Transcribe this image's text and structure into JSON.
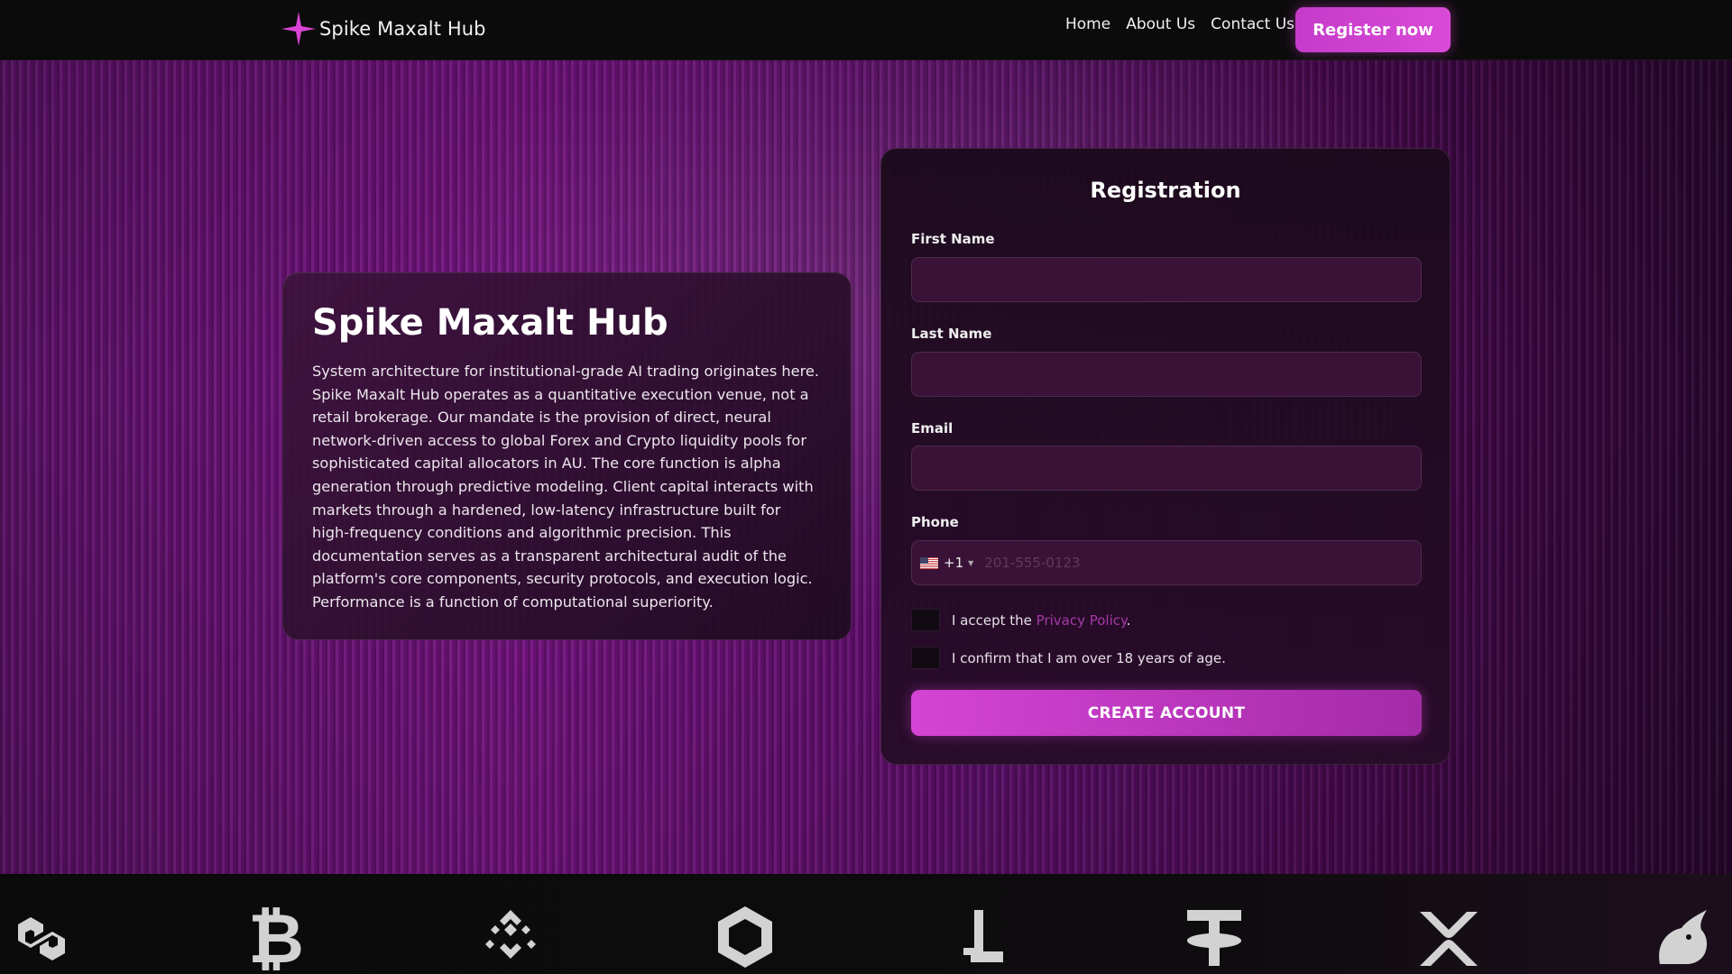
{
  "header": {
    "brand_name": "Spike Maxalt Hub",
    "nav": [
      "Home",
      "About Us",
      "Contact Us"
    ],
    "register_label": "Register now"
  },
  "info": {
    "title": "Spike Maxalt Hub",
    "text": "System architecture for institutional-grade AI trading originates here. Spike Maxalt Hub operates as a quantitative execution venue, not a retail brokerage. Our mandate is the provision of direct, neural network-driven access to global Forex and Crypto liquidity pools for sophisticated capital allocators in AU. The core function is alpha generation through predictive modeling. Client capital interacts with markets through a hardened, low-latency infrastructure built for high-frequency conditions and algorithmic precision. This documentation serves as a transparent architectural audit of the platform's core components, security protocols, and execution logic. Performance is a function of computational superiority."
  },
  "registration": {
    "title": "Registration",
    "first_name_label": "First Name",
    "last_name_label": "Last Name",
    "email_label": "Email",
    "phone_label": "Phone",
    "phone_dial_code": "+1",
    "phone_placeholder": "201-555-0123",
    "privacy_prefix": "I accept the ",
    "privacy_link": "Privacy Policy",
    "privacy_suffix": ".",
    "age_confirm": "I confirm that I am over 18 years of age.",
    "submit_label": "CREATE ACCOUNT"
  },
  "crypto_icons": [
    "polygon-icon",
    "bitcoin-icon",
    "binance-icon",
    "hexagon-icon",
    "lisk-icon",
    "tether-icon",
    "xrp-icon",
    "uniswap-icon"
  ],
  "colors": {
    "accent": "#d94ad7",
    "link": "#a53aa5",
    "hero_base": "#7a1487"
  }
}
